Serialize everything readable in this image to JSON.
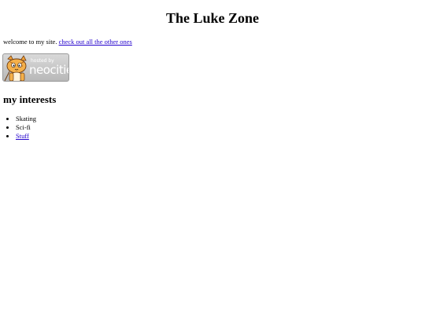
{
  "page": {
    "title": "The Luke Zone",
    "intro_text": "welcome to my site. ",
    "intro_link": "check out all the other ones"
  },
  "badge": {
    "hosted_label": "hosted by",
    "brand": "neocities",
    "icon": "neocities-cat-logo"
  },
  "interests": {
    "heading": "my interests",
    "items": [
      {
        "label": "Skating",
        "link": false
      },
      {
        "label": "Sci-fi",
        "link": false
      },
      {
        "label": "Stuff",
        "link": true
      }
    ]
  },
  "colors": {
    "link": "#2200cc",
    "badge_bg": "#c8c8c8",
    "badge_text": "#ffffff",
    "cat_orange": "#f2a33a"
  }
}
